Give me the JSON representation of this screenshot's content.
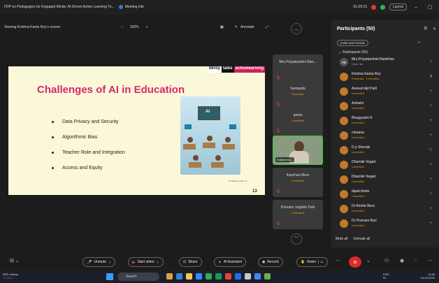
{
  "titlebar": {
    "title": "FDP on Pedagogies for Engaged Minds: AI-Driven Active Learning To...",
    "meeting_info": "Meeting info",
    "time": "01:09:15",
    "layout": "Layout",
    "minimize": "–",
    "restore": "▢",
    "colors": {
      "green_dot": "#2db84c",
      "red_dot": "#e03a3a"
    }
  },
  "viewbar": {
    "viewing": "Viewing Krishna Kanta Roy's screen",
    "zoom_out": "–",
    "zoom": "100%",
    "zoom_in": "+",
    "annotate": "Annotate"
  },
  "slide": {
    "brand": [
      "kkroy",
      "talks",
      "activelearning"
    ],
    "title": "Challenges of AI in Education",
    "bullets": [
      "Data Privacy and Security",
      "Algorithmic Bias",
      "Teacher Role and Integration",
      "Access and Equity"
    ],
    "image_text": "AI",
    "credit": "Created by DALL-E",
    "page_number": "13"
  },
  "tiles": [
    {
      "name": "Mrs.Priyadarshini Ran...",
      "status": ""
    },
    {
      "name": "Sampada",
      "status": "Unverified"
    },
    {
      "name": "geeta",
      "status": "Unverified"
    },
    {
      "name": "Krishna Ka...",
      "status": "",
      "video": true
    },
    {
      "name": "Kanchan More",
      "status": "Unverified"
    },
    {
      "name": "Poonam Jagdish Patil",
      "status": "Unverified"
    }
  ],
  "participants": {
    "title": "Participants (50)",
    "invite": "Invite and remind",
    "group_label": "Participants (50)",
    "list": [
      {
        "initials": "PR",
        "name": "Mrs.Priyadarshini Ranbhise",
        "sub": "Host, me"
      },
      {
        "initials": "",
        "name": "Krishna Kanta Roy",
        "sub": "Presenter · Unverified"
      },
      {
        "initials": "",
        "name": "Asavari Ajit Patil",
        "sub": "Unverified"
      },
      {
        "initials": "",
        "name": "Ashwini",
        "sub": "Unverified"
      },
      {
        "initials": "",
        "name": "Bhagyashri K",
        "sub": "Unverified"
      },
      {
        "initials": "",
        "name": "chetana",
        "sub": "Unverified"
      },
      {
        "initials": "",
        "name": "D p Shende",
        "sub": "Unverified"
      },
      {
        "initials": "",
        "name": "Dharmik Vegad",
        "sub": "Unverified"
      },
      {
        "initials": "",
        "name": "Dharmik Vegad",
        "sub": "Unverified"
      },
      {
        "initials": "",
        "name": "dipali bhole",
        "sub": "Unverified"
      },
      {
        "initials": "",
        "name": "Dr Amrita Bera",
        "sub": "Unverified"
      },
      {
        "initials": "",
        "name": "Dr Poonam Bari",
        "sub": "Unverified"
      }
    ],
    "mute_all": "Mute all",
    "unmute_all": "Unmute all"
  },
  "controls": {
    "unmute": "Unmute",
    "start_video": "Start video",
    "share": "Share",
    "ai_assistant": "AI Assistant",
    "record": "Record",
    "raise": "Raise"
  },
  "taskbar": {
    "weather_title": "BSE midcap",
    "weather_value": "+1.55%",
    "search": "Search",
    "lang": "ENG",
    "lang2": "IN",
    "time": "14:45",
    "date": "18-03-2025"
  }
}
